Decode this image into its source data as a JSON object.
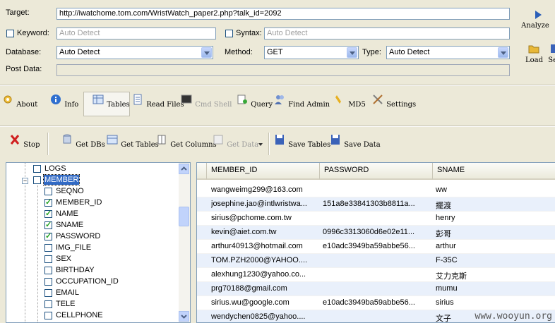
{
  "form": {
    "target_label": "Target:",
    "target_value": "http://iwatchome.tom.com/WristWatch_paper2.php?talk_id=2092",
    "keyword_label": "Keyword:",
    "keyword_placeholder": "Auto Detect",
    "syntax_label": "Syntax:",
    "syntax_placeholder": "Auto Detect",
    "database_label": "Database:",
    "database_value": "Auto Detect",
    "method_label": "Method:",
    "method_value": "GET",
    "type_label": "Type:",
    "type_value": "Auto Detect",
    "postdata_label": "Post Data:",
    "analyze_label": "Analyze",
    "load_label": "Load",
    "save_partial_label": "Se"
  },
  "main_toolbar": {
    "items": [
      {
        "label": "About",
        "icon": "gear-icon",
        "enabled": true
      },
      {
        "label": "Info",
        "icon": "info-icon",
        "enabled": true
      },
      {
        "label": "Tables",
        "icon": "table-icon",
        "enabled": true,
        "active": true
      },
      {
        "label": "Read Files",
        "icon": "document-icon",
        "enabled": true
      },
      {
        "label": "Cmd Shell",
        "icon": "terminal-icon",
        "enabled": false
      },
      {
        "label": "Query",
        "icon": "query-icon",
        "enabled": true
      },
      {
        "label": "Find Admin",
        "icon": "users-icon",
        "enabled": true
      },
      {
        "label": "MD5",
        "icon": "key-icon",
        "enabled": true
      },
      {
        "label": "Settings",
        "icon": "tools-icon",
        "enabled": true
      }
    ]
  },
  "sub_toolbar": {
    "items": [
      {
        "label": "Stop",
        "icon": "stop-icon",
        "enabled": true
      },
      {
        "label": "Get DBs",
        "icon": "database-icon",
        "enabled": true
      },
      {
        "label": "Get Tables",
        "icon": "table-icon",
        "enabled": true
      },
      {
        "label": "Get Columns",
        "icon": "columns-icon",
        "enabled": true
      },
      {
        "label": "Get Data",
        "icon": "data-icon",
        "enabled": false
      },
      {
        "label": "Save Tables",
        "icon": "floppy-icon",
        "enabled": true
      },
      {
        "label": "Save Data",
        "icon": "floppy-icon",
        "enabled": true
      }
    ]
  },
  "tree": {
    "items": [
      {
        "label": "LOGS",
        "checked": false,
        "level": 1
      },
      {
        "label": "MEMBER",
        "checked": false,
        "level": 1,
        "expanded": true,
        "selected": true
      },
      {
        "label": "SEQNO",
        "checked": false,
        "level": 2
      },
      {
        "label": "MEMBER_ID",
        "checked": true,
        "level": 2
      },
      {
        "label": "NAME",
        "checked": true,
        "level": 2
      },
      {
        "label": "SNAME",
        "checked": true,
        "level": 2
      },
      {
        "label": "PASSWORD",
        "checked": true,
        "level": 2
      },
      {
        "label": "IMG_FILE",
        "checked": false,
        "level": 2
      },
      {
        "label": "SEX",
        "checked": false,
        "level": 2
      },
      {
        "label": "BIRTHDAY",
        "checked": false,
        "level": 2
      },
      {
        "label": "OCCUPATION_ID",
        "checked": false,
        "level": 2
      },
      {
        "label": "EMAIL",
        "checked": false,
        "level": 2
      },
      {
        "label": "TELE",
        "checked": false,
        "level": 2
      },
      {
        "label": "CELLPHONE",
        "checked": false,
        "level": 2
      }
    ]
  },
  "grid": {
    "columns": [
      "MEMBER_ID",
      "PASSWORD",
      "SNAME"
    ],
    "rows": [
      [
        "wangweimg299@163.com",
        "",
        "ww"
      ],
      [
        "josephine.jao@intlwristwa...",
        "151a8e33841303b8811a...",
        "擺渡"
      ],
      [
        "sirius@pchome.com.tw",
        "",
        "henry"
      ],
      [
        "kevin@aiet.com.tw",
        "0996c3313060d6e02e11...",
        "彭哥"
      ],
      [
        "arthur40913@hotmail.com",
        "e10adc3949ba59abbe56...",
        "arthur"
      ],
      [
        "TOM.PZH2000@YAHOO....",
        "",
        "F-35C"
      ],
      [
        "alexhung1230@yahoo.co...",
        "",
        "艾力克斯"
      ],
      [
        "prg70188@gmail.com",
        "",
        "mumu"
      ],
      [
        "sirius.wu@google.com",
        "e10adc3949ba59abbe56...",
        "sirius"
      ],
      [
        "wendychen0825@yahoo....",
        "",
        "文子"
      ]
    ]
  },
  "watermark": "www.wooyun.org",
  "colors": {
    "selection": "#316ac5",
    "row_alt": "#e9f0fb",
    "field_border": "#7f9db9"
  }
}
